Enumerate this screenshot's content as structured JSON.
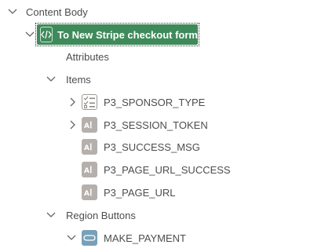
{
  "tree": {
    "content_body": {
      "label": "Content Body"
    },
    "selected_region": {
      "label": "To New Stripe checkout form"
    },
    "attributes": {
      "label": "Attributes"
    },
    "items": {
      "label": "Items",
      "children": [
        {
          "label": "P3_SPONSOR_TYPE",
          "icon": "checkbox-list-icon"
        },
        {
          "label": "P3_SESSION_TOKEN",
          "icon": "text-field-icon"
        },
        {
          "label": "P3_SUCCESS_MSG",
          "icon": "text-field-icon"
        },
        {
          "label": "P3_PAGE_URL_SUCCESS",
          "icon": "text-field-icon"
        },
        {
          "label": "P3_PAGE_URL",
          "icon": "text-field-icon"
        }
      ]
    },
    "region_buttons": {
      "label": "Region Buttons"
    },
    "button": {
      "label": "MAKE_PAYMENT",
      "icon": "button-icon"
    }
  },
  "colors": {
    "selected_bg": "#3f8a5a",
    "item_icon_gray": "#b5b0ab",
    "button_icon_blue": "#77a1b8",
    "text": "#4d4d4d"
  }
}
